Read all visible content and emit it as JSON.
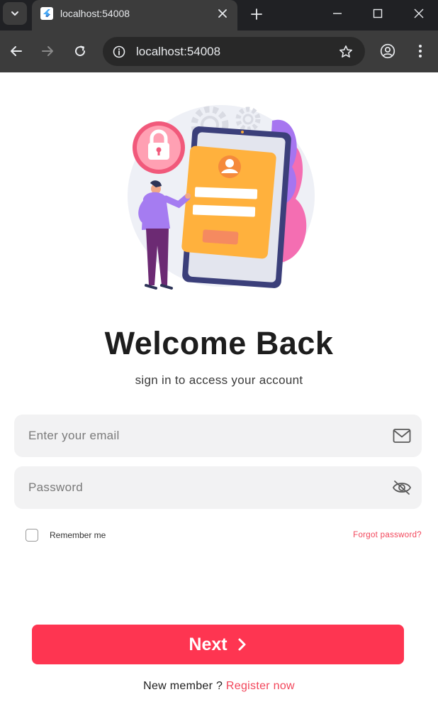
{
  "browser": {
    "tab_title": "localhost:54008",
    "url": "localhost:54008",
    "icons": {
      "tab_menu": "chevron-down-icon",
      "favicon": "flutter-icon",
      "close": "close-icon",
      "new_tab": "plus-icon",
      "back": "arrow-left-icon",
      "forward": "arrow-right-icon",
      "reload": "reload-icon",
      "site_info": "site-info-icon",
      "bookmark": "star-icon",
      "profile": "profile-icon",
      "menu": "kebab-menu-icon"
    }
  },
  "login": {
    "title": "Welcome Back",
    "subtitle": "sign in to access your account",
    "email": {
      "placeholder": "Enter your email",
      "value": "",
      "icon": "mail-icon"
    },
    "password": {
      "placeholder": "Password",
      "value": "",
      "icon": "eye-off-icon"
    },
    "remember_label": "Remember me",
    "remember_checked": false,
    "forgot_label": "Forgot password?",
    "next_label": "Next",
    "signup_prompt": "New member ? ",
    "signup_link": "Register now"
  },
  "colors": {
    "accent": "#fe3551",
    "link": "#f2455a",
    "field_bg": "#f2f2f3",
    "chrome_dark": "#202124",
    "chrome_toolbar": "#3c3c3c"
  }
}
